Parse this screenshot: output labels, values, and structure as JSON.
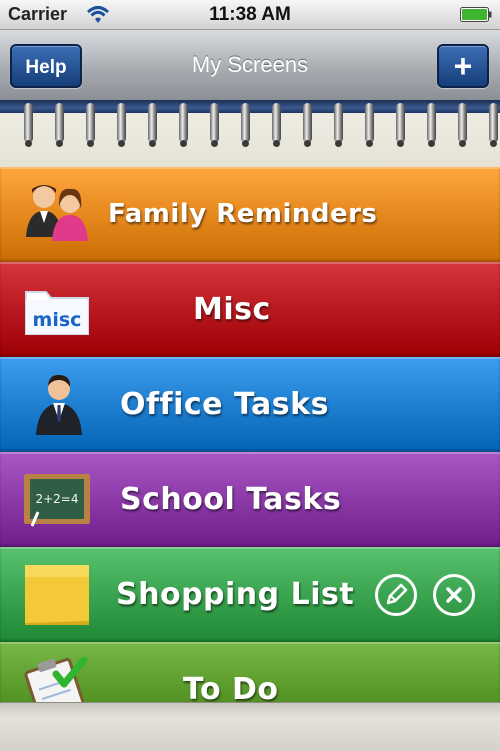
{
  "status_bar": {
    "carrier": "Carrier",
    "time": "11:38 AM"
  },
  "nav": {
    "title": "My Screens",
    "help_label": "Help",
    "add_label": "+"
  },
  "list": {
    "items": [
      {
        "label": "Family Reminders",
        "color": "#e6891f",
        "icon": "family-icon"
      },
      {
        "label": "Misc",
        "color": "#b8191f",
        "icon": "misc-folder-icon"
      },
      {
        "label": "Office Tasks",
        "color": "#1f7fd1",
        "icon": "businessman-icon"
      },
      {
        "label": "School Tasks",
        "color": "#8b3aa8",
        "icon": "chalkboard-icon"
      },
      {
        "label": "Shopping List",
        "color": "#3aa450",
        "icon": "sticky-note-icon"
      },
      {
        "label": "To Do",
        "color": "#5a9a2a",
        "icon": "checklist-icon"
      }
    ],
    "chalkboard_text": "2+2=4",
    "misc_folder_text": "misc"
  },
  "icons": {
    "edit": "pencil-icon",
    "delete": "close-icon"
  }
}
